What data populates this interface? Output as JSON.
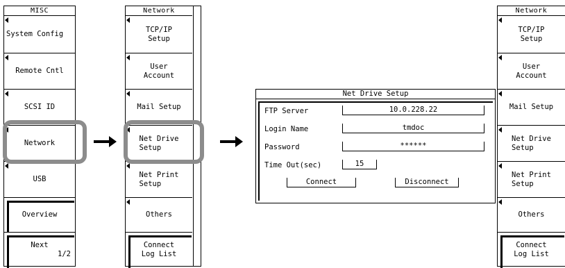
{
  "misc_menu": {
    "title": "MISC",
    "keys": [
      {
        "label": "System Config"
      },
      {
        "label": "Remote Cntl"
      },
      {
        "label": "SCSI ID"
      },
      {
        "label": "Network"
      },
      {
        "label": "USB"
      },
      {
        "label": "Overview"
      },
      {
        "label": "Next",
        "page": "1/2"
      }
    ]
  },
  "network_menu": {
    "title": "Network",
    "keys": [
      {
        "label": "TCP/IP\nSetup"
      },
      {
        "label": "User\nAccount"
      },
      {
        "label": "Mail Setup"
      },
      {
        "label": "Net Drive\nSetup"
      },
      {
        "label": "Net Print\nSetup"
      },
      {
        "label": "Others"
      },
      {
        "label": "Connect\nLog List"
      }
    ]
  },
  "dialog": {
    "title": "Net Drive Setup",
    "ftp_server_label": "FTP Server",
    "ftp_server_value": "10.0.228.22",
    "login_name_label": "Login Name",
    "login_name_value": "tmdoc",
    "password_label": "Password",
    "password_value": "******",
    "timeout_label": "Time Out(sec)",
    "timeout_value": "15",
    "connect_label": "Connect",
    "disconnect_label": "Disconnect"
  },
  "colors": {
    "highlight": "#8c8c8c",
    "foreground": "#000000",
    "background": "#ffffff"
  }
}
